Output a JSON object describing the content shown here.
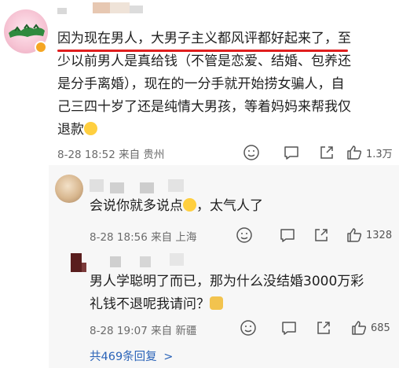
{
  "comment": {
    "text_lines": [
      "因为现在男人，大男子主义都风评都好起来了，至",
      "少以前男人是真给钱（不管是恋爱、结婚、包养还",
      "是分手离婚），现在的一分手就开始捞女骗人，自",
      "己三四十岁了还是纯情大男孩，等着妈妈来帮我仅",
      "退款"
    ],
    "time": "8-28 18:52",
    "location": "来自 贵州",
    "like_count": "1.3万",
    "icons": [
      "emoji-react-icon",
      "comment-icon",
      "share-icon",
      "like-icon"
    ]
  },
  "replies": [
    {
      "text_lines": [
        "会说你就多说点",
        "，太气人了"
      ],
      "time": "8-28 18:56",
      "location": "来自 上海",
      "like_count": "1328"
    },
    {
      "text_lines": [
        "男人学聪明了而已，那为什么没结婚3000万彩",
        "礼钱不退呢我请问？"
      ],
      "time": "8-28 19:07",
      "location": "来自 新疆",
      "like_count": "685"
    }
  ],
  "more_replies": "共469条回复",
  "more_chevron": ">",
  "colors": {
    "underline": "#e01e1e",
    "link": "#2a63b8",
    "meta": "#6b6b6b"
  }
}
